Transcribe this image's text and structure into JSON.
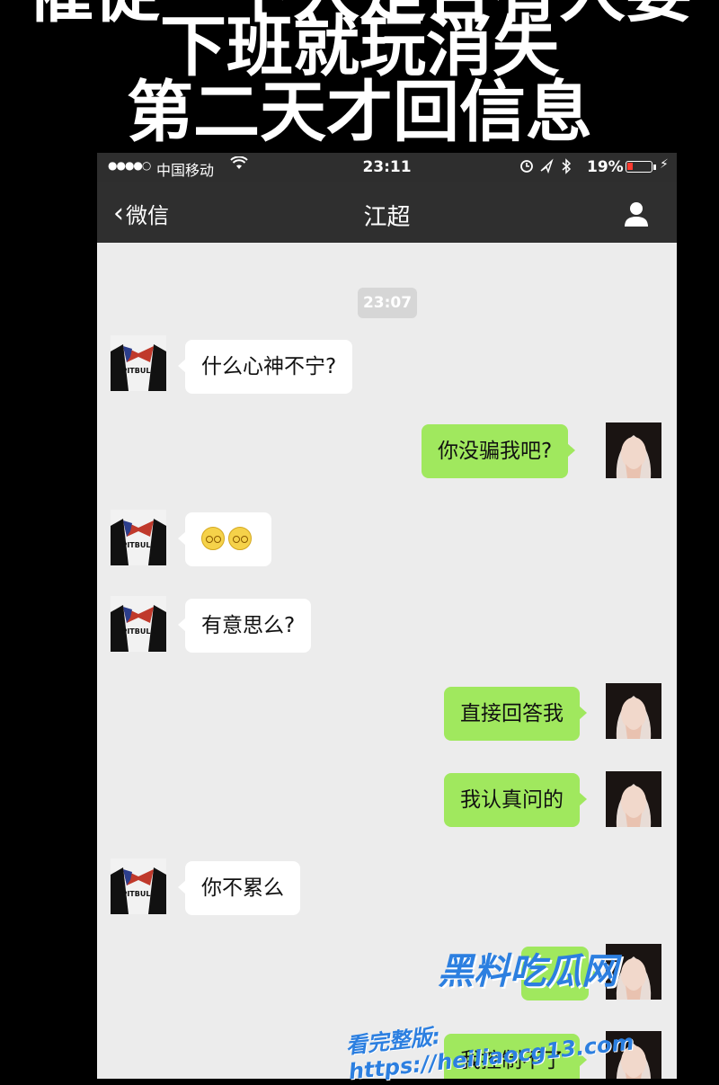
{
  "caption": {
    "line1": "催促一下人是否有人要",
    "line2": "下班就玩消失",
    "line3": "第二天才回信息"
  },
  "status_bar": {
    "signal": "●●●●○",
    "carrier": "中国移动",
    "time": "23:11",
    "battery_percent": "19%"
  },
  "nav": {
    "back_label": "微信",
    "title": "江超"
  },
  "chat": {
    "timestamp": "23:07",
    "messages": [
      {
        "side": "in",
        "text": "什么心神不宁?"
      },
      {
        "side": "out",
        "text": "你没骗我吧?"
      },
      {
        "side": "in",
        "text": "",
        "emoji": "dizzy-face-emoji x2"
      },
      {
        "side": "in",
        "text": "有意思么?"
      },
      {
        "side": "out",
        "text": "直接回答我"
      },
      {
        "side": "out",
        "text": "我认真问的"
      },
      {
        "side": "in",
        "text": "你不累么"
      },
      {
        "side": "out",
        "text": ""
      },
      {
        "side": "out",
        "text": "我控制不了"
      }
    ]
  },
  "watermark": {
    "title": "黑料吃瓜网",
    "url": "看完整版: https://heiliaocg13.com"
  },
  "colors": {
    "background": "#000000",
    "outgoing_bubble": "#a0e85e",
    "incoming_bubble": "#ffffff",
    "navbar": "#2f2f2f",
    "watermark": "#2c7fe0"
  }
}
